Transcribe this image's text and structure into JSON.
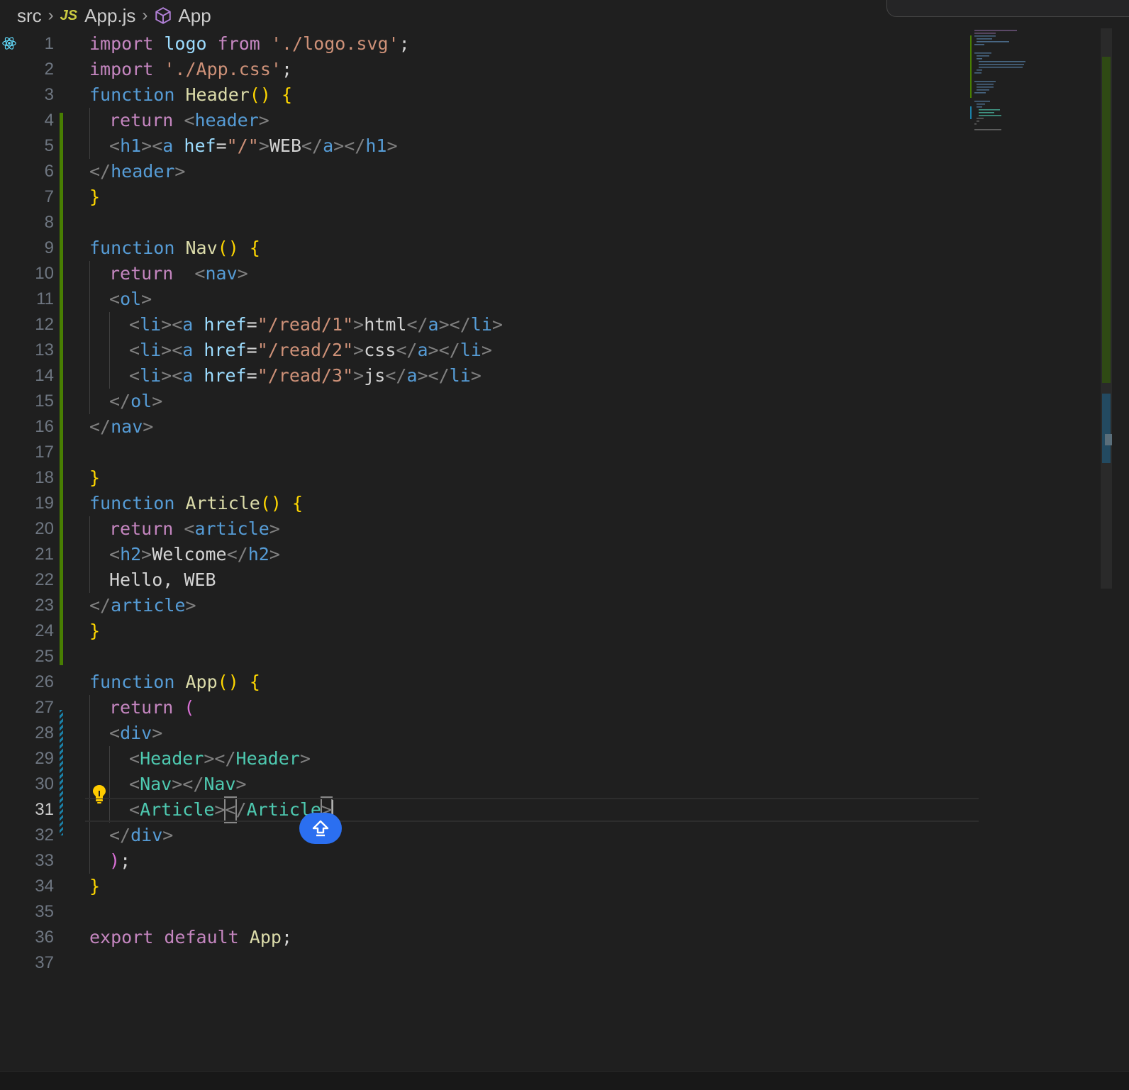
{
  "breadcrumb": {
    "folder": "src",
    "file_badge": "JS",
    "file": "App.js",
    "symbol": "App"
  },
  "icons": {
    "react": "react-icon",
    "lightbulb": "lightbulb-icon",
    "symbol": "cube-icon",
    "fab": "upload-arrow-icon"
  },
  "editor": {
    "active_line": 31,
    "line_numbers": [
      "1",
      "2",
      "3",
      "4",
      "5",
      "6",
      "7",
      "8",
      "9",
      "10",
      "11",
      "12",
      "13",
      "14",
      "15",
      "16",
      "17",
      "18",
      "19",
      "20",
      "21",
      "22",
      "23",
      "24",
      "25",
      "26",
      "27",
      "28",
      "29",
      "30",
      "31",
      "32",
      "33",
      "34",
      "35",
      "36",
      "37"
    ],
    "lines": [
      {
        "indent": 0,
        "tokens": [
          [
            "kw",
            "import"
          ],
          [
            "tx",
            " "
          ],
          [
            "id",
            "logo"
          ],
          [
            "tx",
            " "
          ],
          [
            "kw",
            "from"
          ],
          [
            "tx",
            " "
          ],
          [
            "st",
            "'./logo.svg'"
          ],
          [
            "tx",
            ";"
          ]
        ]
      },
      {
        "indent": 0,
        "tokens": [
          [
            "kw",
            "import"
          ],
          [
            "tx",
            " "
          ],
          [
            "st",
            "'./App.css'"
          ],
          [
            "tx",
            ";"
          ]
        ]
      },
      {
        "indent": 0,
        "tokens": [
          [
            "fn",
            "function"
          ],
          [
            "tx",
            " "
          ],
          [
            "nm",
            "Header"
          ],
          [
            "br1",
            "()"
          ],
          [
            "tx",
            " "
          ],
          [
            "br1",
            "{"
          ]
        ]
      },
      {
        "indent": 1,
        "tokens": [
          [
            "kw",
            "return"
          ],
          [
            "tx",
            " "
          ],
          [
            "pn",
            "<"
          ],
          [
            "tg",
            "header"
          ],
          [
            "pn",
            ">"
          ]
        ]
      },
      {
        "indent": 1,
        "tokens": [
          [
            "pn",
            "<"
          ],
          [
            "tg",
            "h1"
          ],
          [
            "pn",
            "><"
          ],
          [
            "tg",
            "a"
          ],
          [
            "tx",
            " "
          ],
          [
            "at",
            "hef"
          ],
          [
            "tx",
            "="
          ],
          [
            "st",
            "\"/\""
          ],
          [
            "pn",
            ">"
          ],
          [
            "tx",
            "WEB"
          ],
          [
            "pn",
            "</"
          ],
          [
            "tg",
            "a"
          ],
          [
            "pn",
            "></"
          ],
          [
            "tg",
            "h1"
          ],
          [
            "pn",
            ">"
          ]
        ]
      },
      {
        "indent": 0,
        "tokens": [
          [
            "pn",
            "</"
          ],
          [
            "tg",
            "header"
          ],
          [
            "pn",
            ">"
          ]
        ]
      },
      {
        "indent": 0,
        "tokens": [
          [
            "br1",
            "}"
          ]
        ]
      },
      {
        "indent": 0,
        "tokens": []
      },
      {
        "indent": 0,
        "tokens": [
          [
            "fn",
            "function"
          ],
          [
            "tx",
            " "
          ],
          [
            "nm",
            "Nav"
          ],
          [
            "br1",
            "()"
          ],
          [
            "tx",
            " "
          ],
          [
            "br1",
            "{"
          ]
        ]
      },
      {
        "indent": 1,
        "tokens": [
          [
            "kw",
            "return"
          ],
          [
            "tx",
            "  "
          ],
          [
            "pn",
            "<"
          ],
          [
            "tg",
            "nav"
          ],
          [
            "pn",
            ">"
          ]
        ]
      },
      {
        "indent": 1,
        "tokens": [
          [
            "pn",
            "<"
          ],
          [
            "tg",
            "ol"
          ],
          [
            "pn",
            ">"
          ]
        ]
      },
      {
        "indent": 2,
        "tokens": [
          [
            "pn",
            "<"
          ],
          [
            "tg",
            "li"
          ],
          [
            "pn",
            "><"
          ],
          [
            "tg",
            "a"
          ],
          [
            "tx",
            " "
          ],
          [
            "at",
            "href"
          ],
          [
            "tx",
            "="
          ],
          [
            "st",
            "\"/read/1\""
          ],
          [
            "pn",
            ">"
          ],
          [
            "tx",
            "html"
          ],
          [
            "pn",
            "</"
          ],
          [
            "tg",
            "a"
          ],
          [
            "pn",
            "></"
          ],
          [
            "tg",
            "li"
          ],
          [
            "pn",
            ">"
          ]
        ]
      },
      {
        "indent": 2,
        "tokens": [
          [
            "pn",
            "<"
          ],
          [
            "tg",
            "li"
          ],
          [
            "pn",
            "><"
          ],
          [
            "tg",
            "a"
          ],
          [
            "tx",
            " "
          ],
          [
            "at",
            "href"
          ],
          [
            "tx",
            "="
          ],
          [
            "st",
            "\"/read/2\""
          ],
          [
            "pn",
            ">"
          ],
          [
            "tx",
            "css"
          ],
          [
            "pn",
            "</"
          ],
          [
            "tg",
            "a"
          ],
          [
            "pn",
            "></"
          ],
          [
            "tg",
            "li"
          ],
          [
            "pn",
            ">"
          ]
        ]
      },
      {
        "indent": 2,
        "tokens": [
          [
            "pn",
            "<"
          ],
          [
            "tg",
            "li"
          ],
          [
            "pn",
            "><"
          ],
          [
            "tg",
            "a"
          ],
          [
            "tx",
            " "
          ],
          [
            "at",
            "href"
          ],
          [
            "tx",
            "="
          ],
          [
            "st",
            "\"/read/3\""
          ],
          [
            "pn",
            ">"
          ],
          [
            "tx",
            "js"
          ],
          [
            "pn",
            "</"
          ],
          [
            "tg",
            "a"
          ],
          [
            "pn",
            "></"
          ],
          [
            "tg",
            "li"
          ],
          [
            "pn",
            ">"
          ]
        ]
      },
      {
        "indent": 1,
        "tokens": [
          [
            "pn",
            "</"
          ],
          [
            "tg",
            "ol"
          ],
          [
            "pn",
            ">"
          ]
        ]
      },
      {
        "indent": 0,
        "tokens": [
          [
            "pn",
            "</"
          ],
          [
            "tg",
            "nav"
          ],
          [
            "pn",
            ">"
          ]
        ]
      },
      {
        "indent": 0,
        "tokens": []
      },
      {
        "indent": 0,
        "tokens": [
          [
            "br1",
            "}"
          ]
        ]
      },
      {
        "indent": 0,
        "tokens": [
          [
            "fn",
            "function"
          ],
          [
            "tx",
            " "
          ],
          [
            "nm",
            "Article"
          ],
          [
            "br1",
            "()"
          ],
          [
            "tx",
            " "
          ],
          [
            "br1",
            "{"
          ]
        ]
      },
      {
        "indent": 1,
        "tokens": [
          [
            "kw",
            "return"
          ],
          [
            "tx",
            " "
          ],
          [
            "pn",
            "<"
          ],
          [
            "tg",
            "article"
          ],
          [
            "pn",
            ">"
          ]
        ]
      },
      {
        "indent": 1,
        "tokens": [
          [
            "pn",
            "<"
          ],
          [
            "tg",
            "h2"
          ],
          [
            "pn",
            ">"
          ],
          [
            "tx",
            "Welcome"
          ],
          [
            "pn",
            "</"
          ],
          [
            "tg",
            "h2"
          ],
          [
            "pn",
            ">"
          ]
        ]
      },
      {
        "indent": 1,
        "tokens": [
          [
            "tx",
            "Hello, WEB"
          ]
        ]
      },
      {
        "indent": 0,
        "tokens": [
          [
            "pn",
            "</"
          ],
          [
            "tg",
            "article"
          ],
          [
            "pn",
            ">"
          ]
        ]
      },
      {
        "indent": 0,
        "tokens": [
          [
            "br1",
            "}"
          ]
        ]
      },
      {
        "indent": 0,
        "tokens": []
      },
      {
        "indent": 0,
        "tokens": [
          [
            "fn",
            "function"
          ],
          [
            "tx",
            " "
          ],
          [
            "nm",
            "App"
          ],
          [
            "br1",
            "()"
          ],
          [
            "tx",
            " "
          ],
          [
            "br1",
            "{"
          ]
        ]
      },
      {
        "indent": 1,
        "tokens": [
          [
            "kw",
            "return"
          ],
          [
            "tx",
            " "
          ],
          [
            "br2",
            "("
          ]
        ]
      },
      {
        "indent": 1,
        "tokens": [
          [
            "pn",
            "<"
          ],
          [
            "tg",
            "div"
          ],
          [
            "pn",
            ">"
          ]
        ]
      },
      {
        "indent": 2,
        "tokens": [
          [
            "pn",
            "<"
          ],
          [
            "cp",
            "Header"
          ],
          [
            "pn",
            "></"
          ],
          [
            "cp",
            "Header"
          ],
          [
            "pn",
            ">"
          ]
        ]
      },
      {
        "indent": 2,
        "tokens": [
          [
            "pn",
            "<"
          ],
          [
            "cp",
            "Nav"
          ],
          [
            "pn",
            "></"
          ],
          [
            "cp",
            "Nav"
          ],
          [
            "pn",
            ">"
          ]
        ]
      },
      {
        "indent": 2,
        "tokens": [
          [
            "pn",
            "<"
          ],
          [
            "cp",
            "Article"
          ],
          [
            "pn",
            ">"
          ],
          [
            "box",
            "<"
          ],
          [
            "pn",
            "/"
          ],
          [
            "cp",
            "Article"
          ],
          [
            "box",
            ">"
          ],
          [
            "cursor",
            ""
          ]
        ]
      },
      {
        "indent": 1,
        "tokens": [
          [
            "pn",
            "</"
          ],
          [
            "tg",
            "div"
          ],
          [
            "pn",
            ">"
          ]
        ]
      },
      {
        "indent": 1,
        "tokens": [
          [
            "br2",
            ")"
          ],
          [
            "tx",
            ";"
          ]
        ]
      },
      {
        "indent": 0,
        "tokens": [
          [
            "br1",
            "}"
          ]
        ]
      },
      {
        "indent": 0,
        "tokens": []
      },
      {
        "indent": 0,
        "tokens": [
          [
            "kw",
            "export"
          ],
          [
            "tx",
            " "
          ],
          [
            "kw",
            "default"
          ],
          [
            "tx",
            " "
          ],
          [
            "nm",
            "App"
          ],
          [
            "tx",
            ";"
          ]
        ]
      },
      {
        "indent": 0,
        "tokens": []
      }
    ]
  }
}
